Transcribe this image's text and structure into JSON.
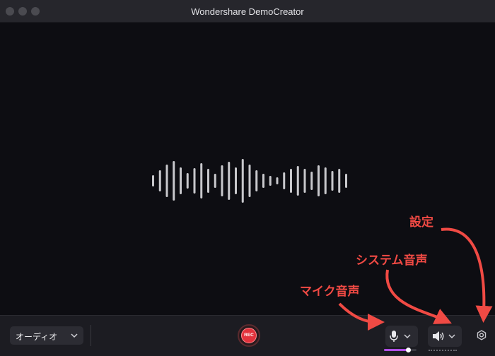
{
  "window": {
    "title": "Wondershare DemoCreator"
  },
  "toolbar": {
    "mode_select": {
      "value": "オーディオ"
    },
    "record_label": "REC",
    "microphone": {
      "level": 0.75,
      "accent_color": "#b04fe6"
    },
    "system_audio": {},
    "settings": {}
  },
  "annotations": {
    "settings_label": "設定",
    "system_audio_label": "システム音声",
    "microphone_label": "マイク音声"
  },
  "colors": {
    "rec_red": "#e3323c",
    "annotation_red": "#f04a44",
    "waveform": "#c8c8cc"
  },
  "icons": [
    "chevron-down-icon",
    "microphone-icon",
    "speaker-icon",
    "gear-icon",
    "waveform-graphic"
  ]
}
